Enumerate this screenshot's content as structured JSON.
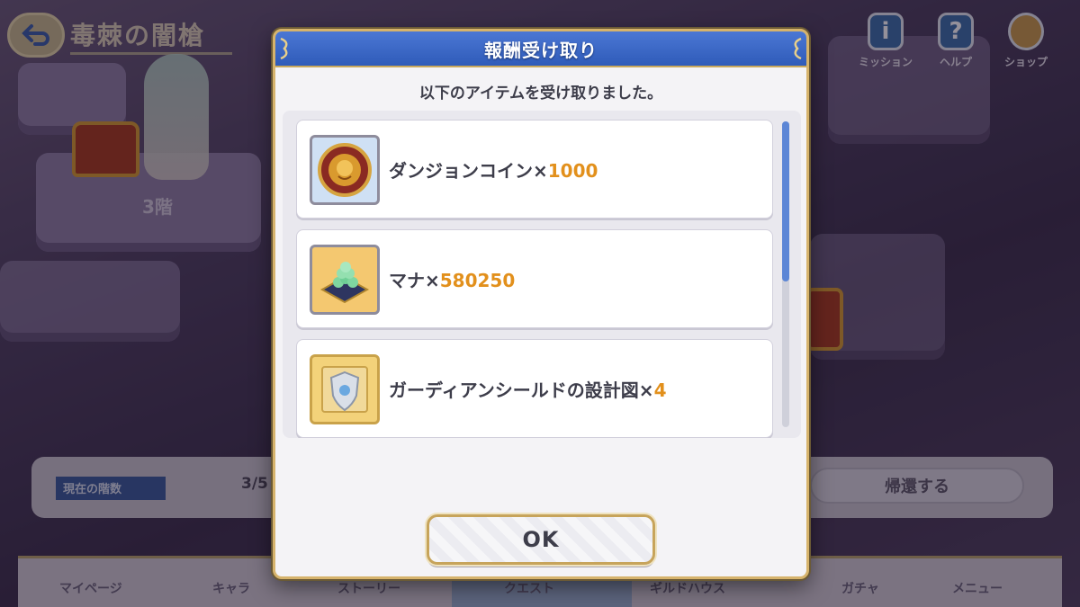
{
  "background": {
    "floor_title": "毒棘の闇槍",
    "floor_label": "3階",
    "top_icons": [
      "ミッション",
      "ヘルプ",
      "ショップ"
    ],
    "status_label": "現在の階数",
    "status_value": "3/5",
    "return_button": "帰還する",
    "nav": [
      "マイページ",
      "キャラ",
      "ストーリー",
      "クエスト",
      "ギルドハウス",
      "ガチャ",
      "メニュー"
    ]
  },
  "modal": {
    "title": "報酬受け取り",
    "subtitle": "以下のアイテムを受け取りました。",
    "items": [
      {
        "name": "ダンジョンコイン×",
        "qty": "1000",
        "icon": "dungeon-coin-icon"
      },
      {
        "name": "マナ×",
        "qty": "580250",
        "icon": "mana-icon"
      },
      {
        "name": "ガーディアンシールドの設計図×",
        "qty": "4",
        "icon": "guardian-shield-blueprint-icon"
      }
    ],
    "ok_label": "OK"
  },
  "colors": {
    "header_blue": "#3a66c6",
    "quantity_orange": "#e2901c",
    "frame_gold": "#d6b36c",
    "scroll_thumb": "#5c86d6"
  }
}
